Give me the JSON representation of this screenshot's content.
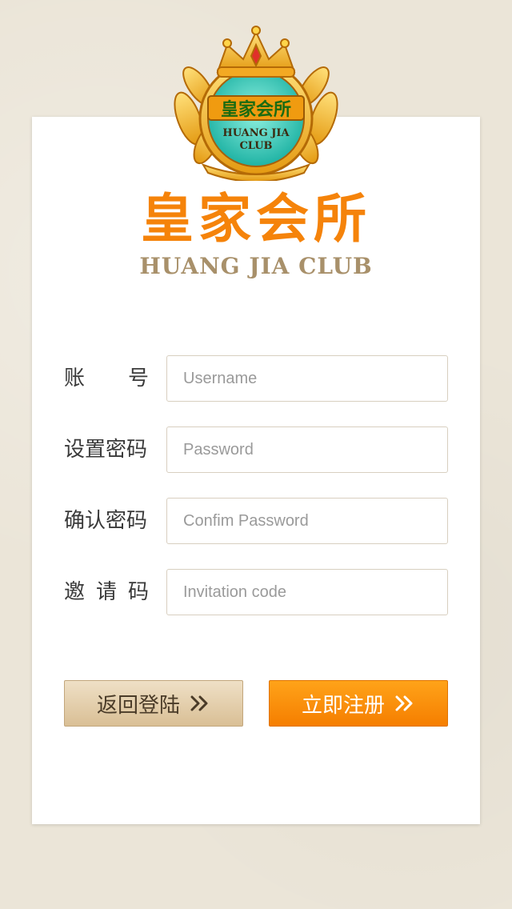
{
  "logo": {
    "badge_cn": "皇家会所",
    "badge_en_line1": "HUANG JIA",
    "badge_en_line2": "CLUB"
  },
  "brand": {
    "title": "皇家会所",
    "subtitle": "HUANG JIA CLUB"
  },
  "form": {
    "username": {
      "label_chars": [
        "账",
        "号"
      ],
      "placeholder": "Username",
      "value": ""
    },
    "password": {
      "label": "设置密码",
      "placeholder": "Password",
      "value": ""
    },
    "confirm": {
      "label": "确认密码",
      "placeholder": "Confim Password",
      "value": ""
    },
    "invite": {
      "label_chars": [
        "邀",
        "请",
        "码"
      ],
      "placeholder": "Invitation code",
      "value": ""
    }
  },
  "buttons": {
    "back_label": "返回登陆",
    "register_label": "立即注册"
  },
  "colors": {
    "accent": "#f5830a",
    "subtitle": "#a8906a",
    "page_bg": "#ebe5d8"
  }
}
